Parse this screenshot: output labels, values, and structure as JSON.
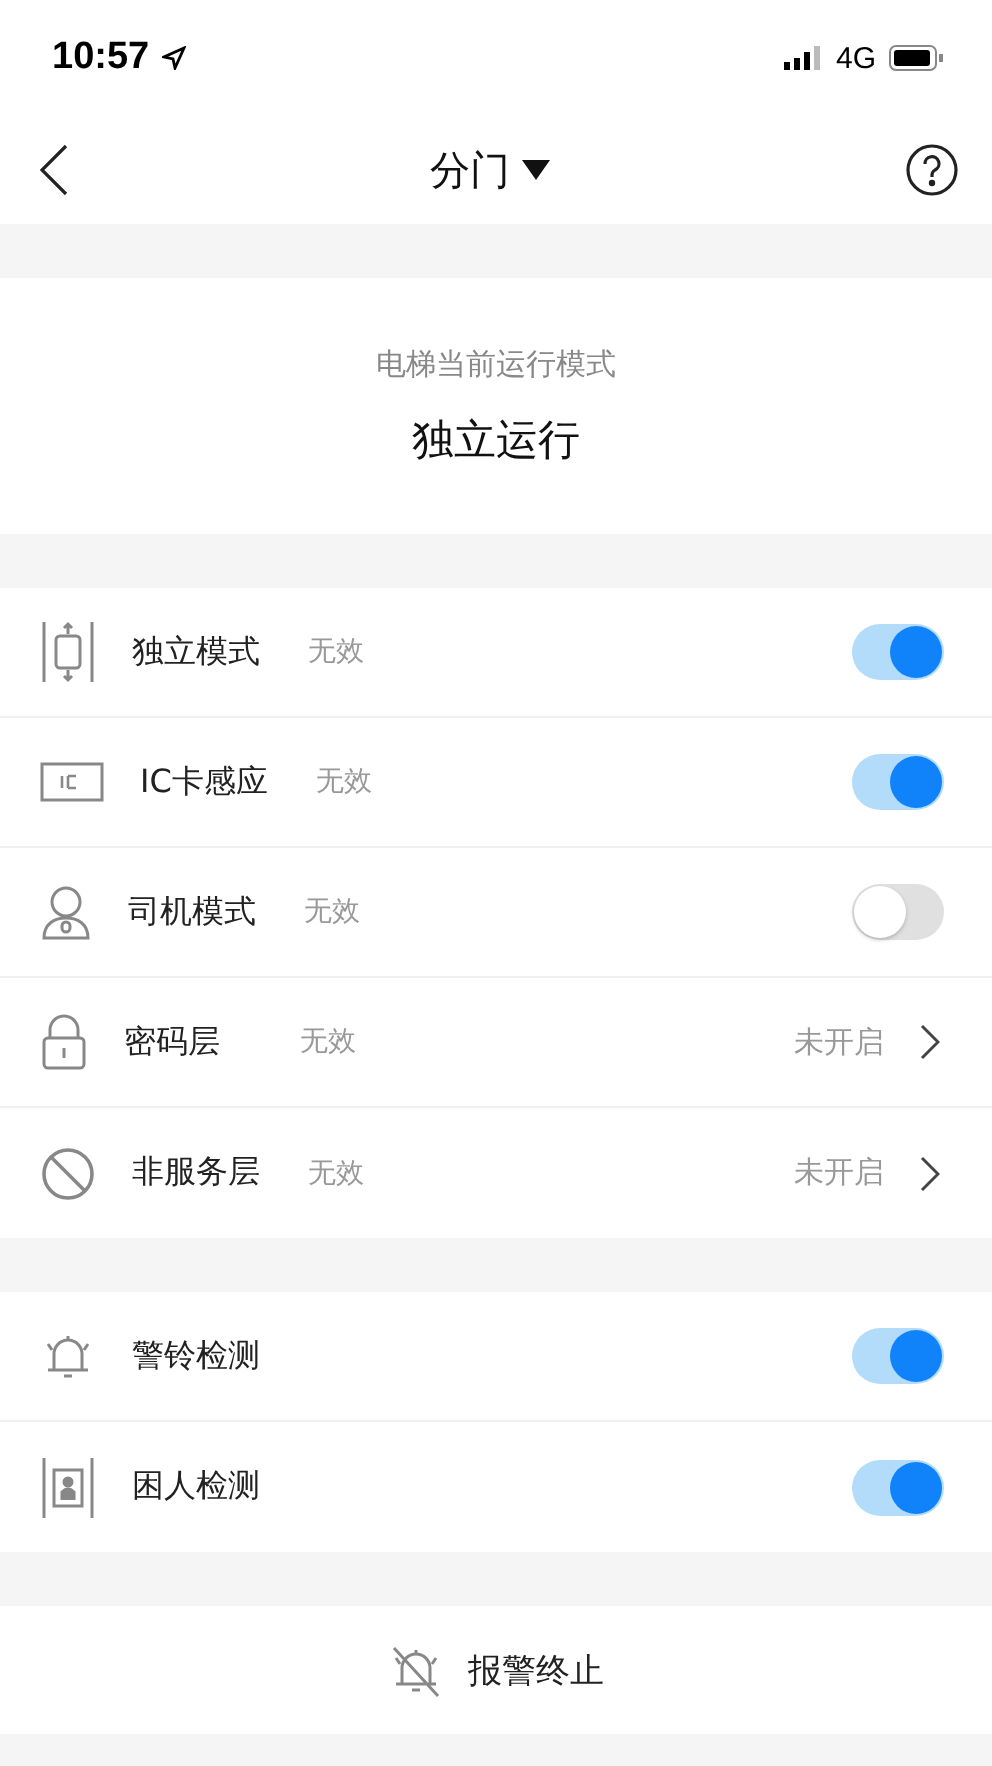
{
  "status_bar": {
    "time": "10:57",
    "network": "4G"
  },
  "nav": {
    "title": "分门"
  },
  "mode": {
    "caption": "电梯当前运行模式",
    "value": "独立运行"
  },
  "settings": [
    {
      "kind": "toggle",
      "label": "独立模式",
      "status": "无效",
      "on": true
    },
    {
      "kind": "toggle",
      "label": "IC卡感应",
      "status": "无效",
      "on": true
    },
    {
      "kind": "toggle",
      "label": "司机模式",
      "status": "无效",
      "on": false
    },
    {
      "kind": "link",
      "label": "密码层",
      "status": "无效",
      "value": "未开启"
    },
    {
      "kind": "link",
      "label": "非服务层",
      "status": "无效",
      "value": "未开启"
    }
  ],
  "detection": [
    {
      "kind": "toggle",
      "label": "警铃检测",
      "on": true
    },
    {
      "kind": "toggle",
      "label": "困人检测",
      "on": true
    }
  ],
  "stop_alarm": {
    "label": "报警终止"
  }
}
